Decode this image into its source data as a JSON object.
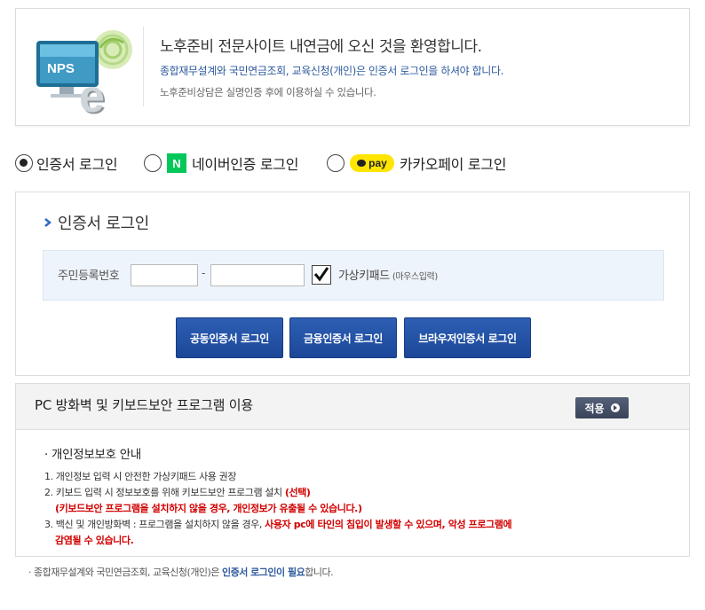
{
  "banner": {
    "logo_text": "NPS",
    "title": "노후준비 전문사이트 내연금에 오신 것을 환영합니다.",
    "line2": "종합재무설계와 국민연금조회, 교육신청(개인)은 인증서 로그인을 하셔야 합니다.",
    "line3": "노후준비상담은 실명인증 후에 이용하실 수 있습니다."
  },
  "login_methods": [
    {
      "label": "인증서 로그인",
      "selected": true
    },
    {
      "label": "네이버인증 로그인",
      "selected": false,
      "badge": "N"
    },
    {
      "label": "카카오페이 로그인",
      "selected": false,
      "badge": "pay"
    }
  ],
  "cert_login": {
    "heading": "인증서 로그인",
    "resident_number_label": "주민등록번호",
    "dash": "-",
    "virtual_keypad_label": "가상키패드",
    "virtual_keypad_note": "(마우스입력)",
    "virtual_keypad_checked": true,
    "buttons": [
      "공동인증서 로그인",
      "금융인증서 로그인",
      "브라우저인증서 로그인"
    ]
  },
  "pc_security": {
    "title": "PC 방화벽 및 키보드보안 프로그램 이용",
    "apply_button": "적용",
    "notice_title": "· 개인정보보호 안내",
    "item1": "1. 개인정보 입력 시 안전한 가상키패드 사용 권장",
    "item2_prefix": "2. 키보드 입력 시 정보보호를 위해 키보드보안 프로그램 설치",
    "item2_select": "(선택)",
    "item2_warning": "(키보드보안 프로그램을 설치하지 않을 경우, 개인정보가 유출될 수 있습니다.)",
    "item3_prefix": "3. 백신 및 개인방화벽 : 프로그램을 설치하지 않을 경우,",
    "item3_warning_a": "사용자 pc에 타인의 침입이 발생할 수 있으며, 악성 프로그램에",
    "item3_warning_b": "감염될 수 있습니다."
  },
  "footer": {
    "prefix": "· 종합재무설계와 국민연금조회, 교육신청(개인)은",
    "highlight": "인증서 로그인이 필요",
    "suffix": "합니다."
  },
  "colors": {
    "accent_blue": "#1c4799",
    "warning_red": "#d20000",
    "naver_green": "#03c75a",
    "kakao_yellow": "#ffe500"
  }
}
